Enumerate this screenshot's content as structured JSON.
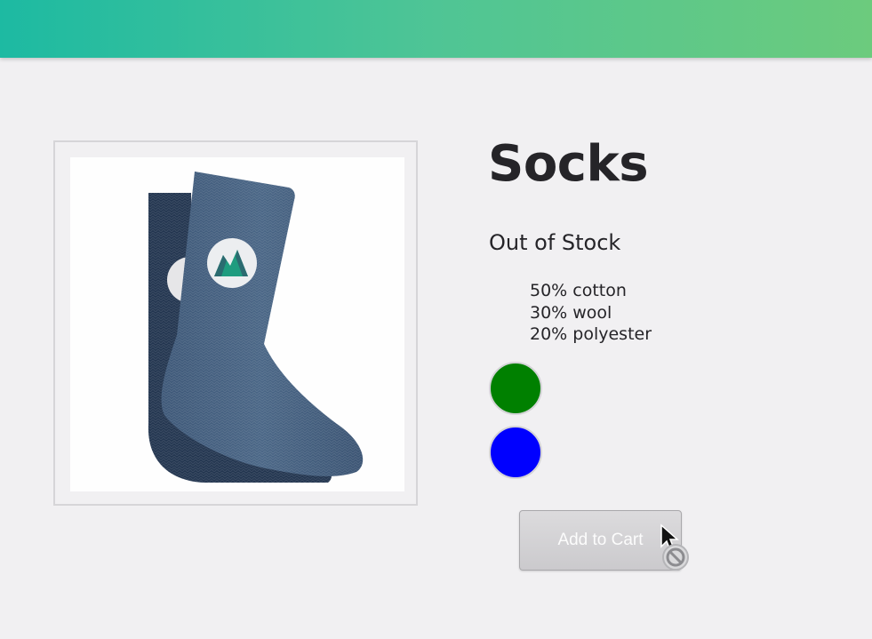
{
  "product": {
    "name": "Socks",
    "stock_status": "Out of Stock",
    "details": [
      "50% cotton",
      "30% wool",
      "20% polyester"
    ],
    "image": {
      "icon": "sock-image",
      "logo": "mountain-logo"
    }
  },
  "variants": [
    {
      "color": "#008000"
    },
    {
      "color": "#0000ff"
    }
  ],
  "add_to_cart": {
    "label": "Add to Cart",
    "disabled": true
  },
  "theme": {
    "header_gradient": [
      "#1dbaa2",
      "#6ccb7d"
    ],
    "sock_color": "#45607f",
    "sock_back_color": "#233650",
    "logo_colors": [
      "#1a9a7e",
      "#2d6a73"
    ]
  },
  "cursor": {
    "icon": "not-allowed-cursor-icon"
  }
}
